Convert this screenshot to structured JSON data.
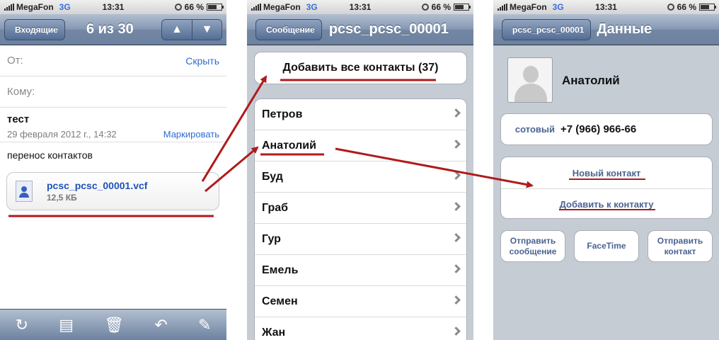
{
  "status": {
    "carrier": "MegaFon",
    "network": "3G",
    "time": "13:31",
    "battery": "66 %",
    "battery_level": 0.66
  },
  "mail": {
    "back_label": "Входящие",
    "title": "6 из 30",
    "up_icon": "▲",
    "down_icon": "▼",
    "from_label": "От:",
    "hide_label": "Скрыть",
    "to_label": "Кому:",
    "subject": "тест",
    "date": "29 февраля 2012 г., 14:32",
    "mark_label": "Маркировать",
    "body": "перенос контактов",
    "attachment_name": "pcsc_pcsc_00001.vcf",
    "attachment_size": "12,5 КБ",
    "toolbar": [
      "refresh-icon",
      "folder-icon",
      "trash-icon",
      "reply-icon",
      "compose-icon"
    ],
    "toolbar_glyphs": [
      "↻",
      "▤",
      "🗑",
      "↶",
      "✎"
    ]
  },
  "contacts": {
    "back_label": "Сообщение",
    "title": "pcsc_pcsc_00001",
    "add_all_label": "Добавить все контакты (37)",
    "items": [
      "Петров",
      "Анатолий",
      "Буд",
      "Граб",
      "Гур",
      "Емель",
      "Семен",
      "Жан"
    ]
  },
  "detail": {
    "back_label": "pcsc_pcsc_00001",
    "title": "Данные",
    "name": "Анатолий",
    "phone_label": "сотовый",
    "phone_value": "+7 (966) 966-66",
    "new_contact_label": "Новый контакт",
    "add_to_contact_label": "Добавить к контакту",
    "send_message_label": "Отправить сообщение",
    "facetime_label": "FaceTime",
    "send_contact_label": "Отправить контакт"
  },
  "annotation_color": "#b01a1a"
}
